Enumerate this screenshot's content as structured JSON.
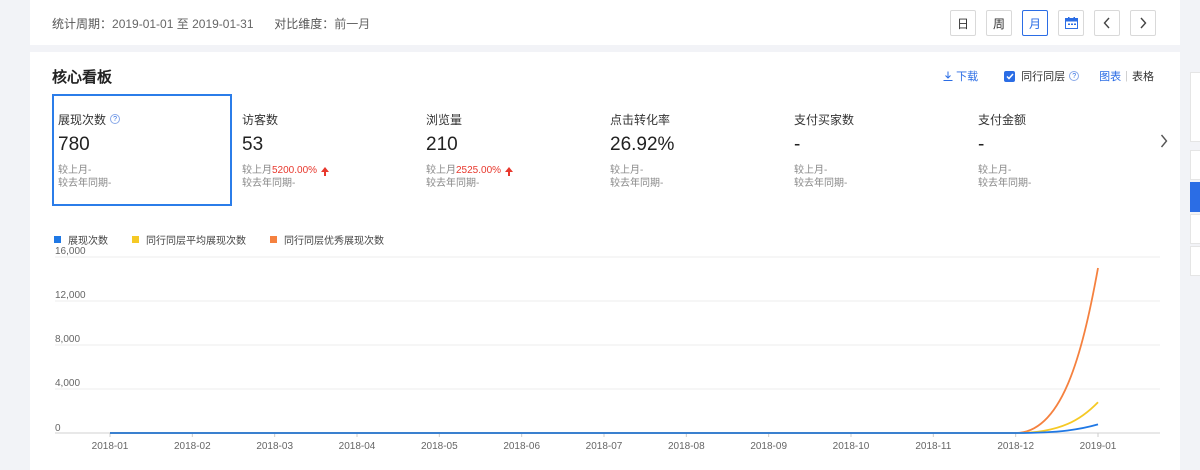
{
  "filter": {
    "period_label": "统计周期：",
    "period_start": "2019-01-01",
    "period_sep": "至",
    "period_end": "2019-01-31",
    "compare_label": "对比维度：",
    "compare_value": "前一月"
  },
  "range_buttons": {
    "day": "日",
    "week": "周",
    "month": "月",
    "active": "月"
  },
  "panel": {
    "title": "核心看板",
    "download": "下载",
    "peer_toggle": "同行同层",
    "peer_checked": true,
    "tab_chart": "图表",
    "tab_separator": "|",
    "tab_table": "表格",
    "active_tab": "图表"
  },
  "kpis": [
    {
      "label": "展现次数",
      "has_help": true,
      "value": "780",
      "cmp_month_label": "较上月",
      "cmp_month_value": "-",
      "cmp_year_label": "较去年同期",
      "cmp_year_value": "-",
      "trend": "none",
      "selected": true
    },
    {
      "label": "访客数",
      "has_help": false,
      "value": "53",
      "cmp_month_label": "较上月",
      "cmp_month_value": "5200.00%",
      "cmp_year_label": "较去年同期",
      "cmp_year_value": "-",
      "trend": "up",
      "selected": false
    },
    {
      "label": "浏览量",
      "has_help": false,
      "value": "210",
      "cmp_month_label": "较上月",
      "cmp_month_value": "2525.00%",
      "cmp_year_label": "较去年同期",
      "cmp_year_value": "-",
      "trend": "up",
      "selected": false
    },
    {
      "label": "点击转化率",
      "has_help": false,
      "value": "26.92%",
      "cmp_month_label": "较上月",
      "cmp_month_value": "-",
      "cmp_year_label": "较去年同期",
      "cmp_year_value": "-",
      "trend": "none",
      "selected": false
    },
    {
      "label": "支付买家数",
      "has_help": false,
      "value": "-",
      "cmp_month_label": "较上月",
      "cmp_month_value": "-",
      "cmp_year_label": "较去年同期",
      "cmp_year_value": "-",
      "trend": "none",
      "selected": false
    },
    {
      "label": "支付金额",
      "has_help": false,
      "value": "-",
      "cmp_month_label": "较上月",
      "cmp_month_value": "-",
      "cmp_year_label": "较去年同期",
      "cmp_year_value": "-",
      "trend": "none",
      "selected": false
    }
  ],
  "colors": {
    "accent": "#2b6de5",
    "up": "#e8382d",
    "s1": "#1f78e5",
    "s2": "#f5c925",
    "s3": "#f5813f"
  },
  "chart_data": {
    "type": "line",
    "x": [
      "2018-01",
      "2018-02",
      "2018-03",
      "2018-04",
      "2018-05",
      "2018-06",
      "2018-07",
      "2018-08",
      "2018-09",
      "2018-10",
      "2018-11",
      "2018-12",
      "2019-01"
    ],
    "y_ticks": [
      "0",
      "4,000",
      "8,000",
      "12,000",
      "16,000"
    ],
    "ylim": [
      0,
      16000
    ],
    "grid": true,
    "legend_position": "top-left",
    "series": [
      {
        "name": "展现次数",
        "color": "#1f78e5",
        "values": [
          0,
          0,
          0,
          0,
          0,
          0,
          0,
          0,
          0,
          0,
          0,
          0,
          780
        ]
      },
      {
        "name": "同行同层平均展现次数",
        "color": "#f5c925",
        "values": [
          0,
          0,
          0,
          0,
          0,
          0,
          0,
          0,
          0,
          0,
          0,
          0,
          2800
        ]
      },
      {
        "name": "同行同层优秀展现次数",
        "color": "#f5813f",
        "values": [
          0,
          0,
          0,
          0,
          0,
          0,
          0,
          0,
          0,
          0,
          0,
          0,
          15000
        ]
      }
    ]
  }
}
